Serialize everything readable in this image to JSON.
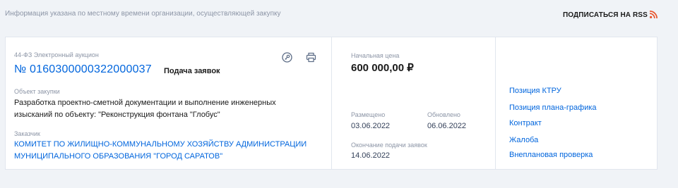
{
  "header": {
    "note": "Информация указана по местному времени организации, осуществляющей закупку",
    "rss_label": "ПОДПИСАТЬСЯ НА RSS",
    "rss_icon": "rss-icon",
    "rss_color": "#e8532b"
  },
  "purchase": {
    "law_type": "44-ФЗ Электронный аукцион",
    "number": "№ 0160300000322000037",
    "stage": "Подача заявок",
    "object_label": "Объект закупки",
    "object_text": "Разработка проектно-сметной документации и выполнение инженерных изысканий по  объекту: \"Реконструкция фонтана \"Глобус\"",
    "customer_label": "Заказчик",
    "customer_text": "КОМИТЕТ ПО ЖИЛИЩНО-КОММУНАЛЬНОМУ ХОЗЯЙСТВУ АДМИНИСТРАЦИИ МУНИЦИПАЛЬНОГО ОБРАЗОВАНИЯ \"ГОРОД САРАТОВ\""
  },
  "pricing": {
    "price_label": "Начальная цена",
    "price": "600 000,00 ₽",
    "placed_label": "Размещено",
    "placed": "03.06.2022",
    "updated_label": "Обновлено",
    "updated": "06.06.2022",
    "deadline_label": "Окончание подачи заявок",
    "deadline": "14.06.2022"
  },
  "links": [
    "Позиция КТРУ",
    "Позиция плана-графика",
    "Контракт",
    "Жалоба",
    "Внеплановая проверка"
  ],
  "colors": {
    "link": "#0065dd",
    "background": "#f0f3f7"
  }
}
